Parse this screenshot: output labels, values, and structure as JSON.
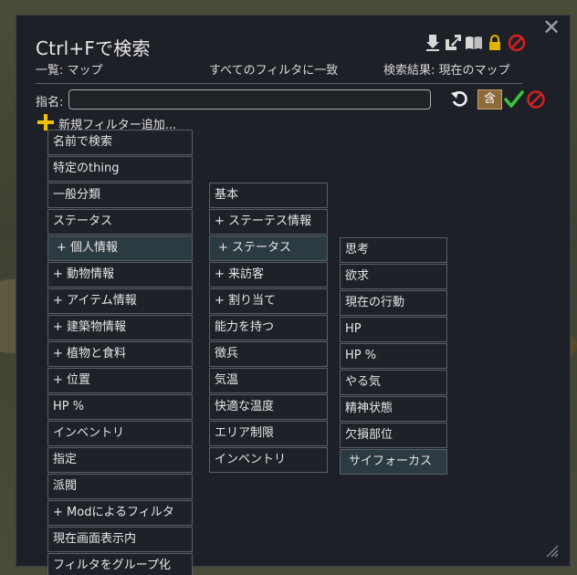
{
  "window": {
    "title": "Ctrl+Fで検索",
    "list_label": "一覧: マップ",
    "match_label": "すべてのフィルタに一致",
    "result_label": "検索結果: 現在のマップ",
    "name_label": "指名:",
    "name_value": "",
    "include_button": "含",
    "add_filter_label": "新規フィルター追加..."
  },
  "toolbar": {
    "icons": [
      "download-icon",
      "export-icon",
      "book-icon",
      "lock-icon",
      "forbid-icon"
    ]
  },
  "menus": {
    "level1": [
      "名前で検索",
      "特定のthing",
      "一般分類",
      "ステータス",
      "+ 個人情報",
      "+ 動物情報",
      "+ アイテム情報",
      "+ 建築物情報",
      "+ 植物と食料",
      "+ 位置",
      "HP %",
      "インベントリ",
      "指定",
      "派閥",
      "+ Modによるフィルタ",
      "現在画面表示内",
      "フィルタをグループ化"
    ],
    "level2": [
      "基本",
      "+ ステーテス情報",
      "+ ステータス",
      "+ 来訪客",
      "+ 割り当て",
      "能力を持つ",
      "徴兵",
      "気温",
      "快適な温度",
      "エリア制限",
      "インベントリ"
    ],
    "level3": [
      "思考",
      "欲求",
      "現在の行動",
      "HP",
      "HP %",
      "やる気",
      "精神状態",
      "欠損部位",
      "サイフォーカス"
    ],
    "level1_selected": 4,
    "level2_selected": 2,
    "level3_selected": 8
  },
  "colors": {
    "window_bg": "#1d2127",
    "item_border": "#5a6068",
    "highlight_bg": "#2c3a41",
    "accent_green": "#3ec43e",
    "accent_red": "#d42020",
    "accent_yellow": "#f2c200"
  }
}
